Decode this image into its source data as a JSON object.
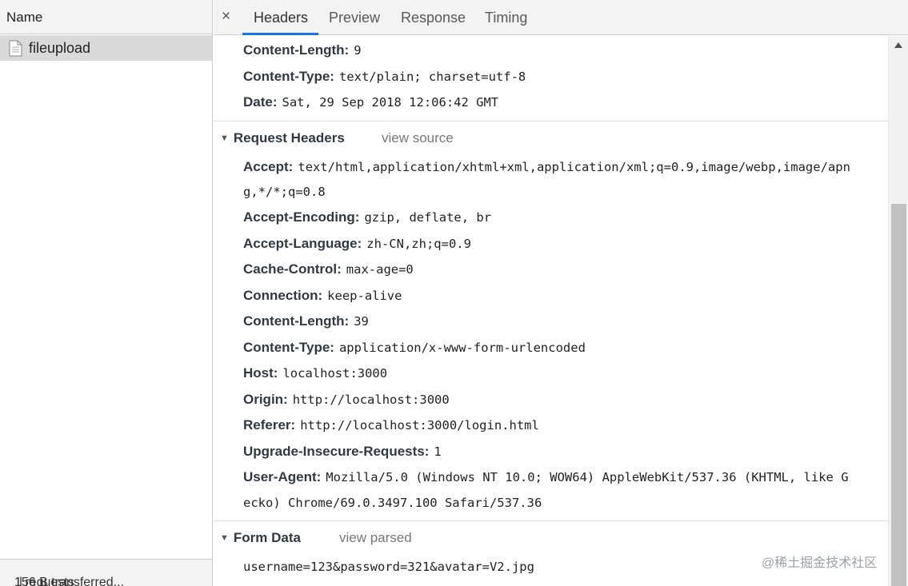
{
  "left_pane": {
    "column_header": "Name",
    "requests": [
      {
        "name": "fileupload"
      }
    ],
    "footer": {
      "requests": "1 requests",
      "transferred": "156 B transferred..."
    }
  },
  "tabs": [
    {
      "label": "×"
    },
    {
      "label": "Headers",
      "active": true
    },
    {
      "label": "Preview"
    },
    {
      "label": "Response"
    },
    {
      "label": "Timing"
    }
  ],
  "response_headers": [
    {
      "name": "Content-Length:",
      "value": "9"
    },
    {
      "name": "Content-Type:",
      "value": "text/plain; charset=utf-8"
    },
    {
      "name": "Date:",
      "value": "Sat, 29 Sep 2018 12:06:42 GMT"
    }
  ],
  "request_headers": {
    "title": "Request Headers",
    "link": "view source",
    "items": [
      {
        "name": "Accept:",
        "value": "text/html,application/xhtml+xml,application/xml;q=0.9,image/webp,image/apn",
        "cont": "g,*/*;q=0.8"
      },
      {
        "name": "Accept-Encoding:",
        "value": "gzip, deflate, br"
      },
      {
        "name": "Accept-Language:",
        "value": "zh-CN,zh;q=0.9"
      },
      {
        "name": "Cache-Control:",
        "value": "max-age=0"
      },
      {
        "name": "Connection:",
        "value": "keep-alive"
      },
      {
        "name": "Content-Length:",
        "value": "39"
      },
      {
        "name": "Content-Type:",
        "value": "application/x-www-form-urlencoded"
      },
      {
        "name": "Host:",
        "value": "localhost:3000"
      },
      {
        "name": "Origin:",
        "value": "http://localhost:3000"
      },
      {
        "name": "Referer:",
        "value": "http://localhost:3000/login.html"
      },
      {
        "name": "Upgrade-Insecure-Requests:",
        "value": "1"
      },
      {
        "name": "User-Agent:",
        "value": "Mozilla/5.0 (Windows NT 10.0; WOW64) AppleWebKit/537.36 (KHTML, like G",
        "cont": "ecko) Chrome/69.0.3497.100 Safari/537.36"
      }
    ]
  },
  "form_data": {
    "title": "Form Data",
    "link": "view parsed",
    "raw": "username=123&password=321&avatar=V2.jpg"
  },
  "watermark": "@稀土掘金技术社区",
  "colors": {
    "accent": "#1a73e8",
    "selected_row": "#dadada",
    "toolbar_bg": "#f3f3f3"
  }
}
